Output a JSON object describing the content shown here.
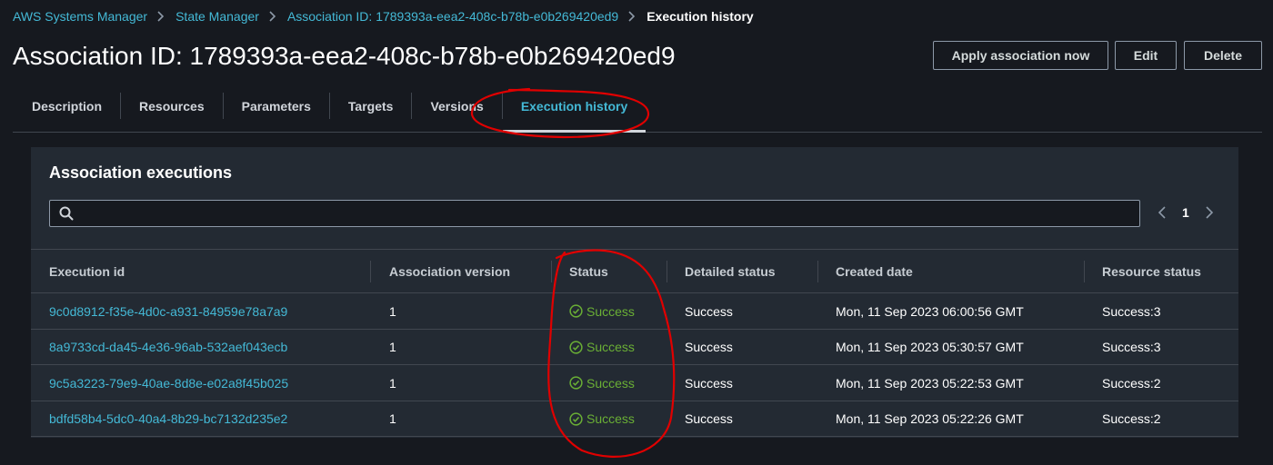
{
  "breadcrumb": {
    "items": [
      "AWS Systems Manager",
      "State Manager",
      "Association ID: 1789393a-eea2-408c-b78b-e0b269420ed9"
    ],
    "current": "Execution history"
  },
  "page": {
    "title": "Association ID: 1789393a-eea2-408c-b78b-e0b269420ed9",
    "actions": {
      "apply": "Apply association now",
      "edit": "Edit",
      "delete": "Delete"
    }
  },
  "tabs": [
    "Description",
    "Resources",
    "Parameters",
    "Targets",
    "Versions",
    "Execution history"
  ],
  "active_tab": "Execution history",
  "executions": {
    "title": "Association executions",
    "search_placeholder": "",
    "page": "1",
    "columns": [
      "Execution id",
      "Association version",
      "Status",
      "Detailed status",
      "Created date",
      "Resource status"
    ],
    "rows": [
      {
        "id": "9c0d8912-f35e-4d0c-a931-84959e78a7a9",
        "version": "1",
        "status": "Success",
        "detailed": "Success",
        "created": "Mon, 11 Sep 2023 06:00:56 GMT",
        "resource": "Success:3"
      },
      {
        "id": "8a9733cd-da45-4e36-96ab-532aef043ecb",
        "version": "1",
        "status": "Success",
        "detailed": "Success",
        "created": "Mon, 11 Sep 2023 05:30:57 GMT",
        "resource": "Success:3"
      },
      {
        "id": "9c5a3223-79e9-40ae-8d8e-e02a8f45b025",
        "version": "1",
        "status": "Success",
        "detailed": "Success",
        "created": "Mon, 11 Sep 2023 05:22:53 GMT",
        "resource": "Success:2"
      },
      {
        "id": "bdfd58b4-5dc0-40a4-8b29-bc7132d235e2",
        "version": "1",
        "status": "Success",
        "detailed": "Success",
        "created": "Mon, 11 Sep 2023 05:22:26 GMT",
        "resource": "Success:2"
      }
    ]
  },
  "colors": {
    "link": "#44b9d6",
    "success": "#6aaf35",
    "annotation": "#e00000",
    "background": "#16191f",
    "panel": "#232a33"
  }
}
